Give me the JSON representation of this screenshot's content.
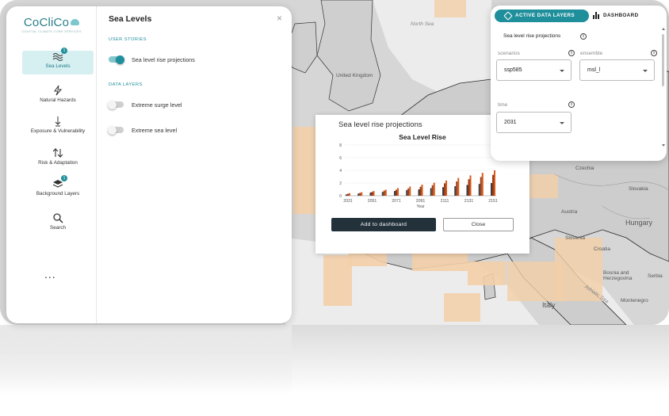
{
  "app": {
    "logo_text": "CoCliCo",
    "logo_tagline": "COASTAL CLIMATE CORE SERVICES"
  },
  "sidebar": {
    "items": [
      {
        "label": "Sea Levels",
        "icon": "waves-icon",
        "badge": "1",
        "active": true
      },
      {
        "label": "Natural Hazards",
        "icon": "lightning-icon"
      },
      {
        "label": "Exposure & Vulnerability",
        "icon": "arrow-down-icon"
      },
      {
        "label": "Risk & Adaptation",
        "icon": "swap-arrows-icon"
      },
      {
        "label": "Background Layers",
        "icon": "layers-icon",
        "badge": "1"
      },
      {
        "label": "Search",
        "icon": "search-icon"
      }
    ],
    "more_label": "..."
  },
  "content": {
    "title": "Sea Levels",
    "close_label": "×",
    "user_stories_heading": "USER STORIES",
    "user_stories": [
      {
        "label": "Sea level rise projections",
        "on": true
      }
    ],
    "data_layers_heading": "DATA LAYERS",
    "data_layers": [
      {
        "label": "Extreme surge level",
        "on": false
      },
      {
        "label": "Extreme sea level",
        "on": false
      }
    ]
  },
  "popup": {
    "title": "Sea level rise projections",
    "add_button": "Add to dashboard",
    "close_button": "Close"
  },
  "chart_data": {
    "type": "bar",
    "title": "Sea Level Rise",
    "xlabel": "Year",
    "ylabel": "",
    "ylim": [
      0,
      8
    ],
    "yticks": [
      0,
      2,
      4,
      6,
      8
    ],
    "x_tick_labels": [
      "2031",
      "2051",
      "2071",
      "2091",
      "2111",
      "2131",
      "2151"
    ],
    "categories": [
      "2031",
      "2041",
      "2051",
      "2061",
      "2071",
      "2081",
      "2091",
      "2101",
      "2111",
      "2121",
      "2131",
      "2141",
      "2151"
    ],
    "series": [
      {
        "color": "#3d3d3d",
        "values": [
          0.2,
          0.35,
          0.5,
          0.6,
          0.75,
          0.9,
          1.0,
          1.2,
          1.35,
          1.5,
          1.7,
          1.85,
          2.0
        ]
      },
      {
        "color": "#9a3b1a",
        "values": [
          0.3,
          0.45,
          0.6,
          0.8,
          0.95,
          1.15,
          1.4,
          1.65,
          1.95,
          2.25,
          2.6,
          2.95,
          3.3
        ]
      },
      {
        "color": "#d65a1a",
        "values": [
          0.4,
          0.55,
          0.75,
          0.95,
          1.2,
          1.45,
          1.75,
          2.05,
          2.4,
          2.8,
          3.2,
          3.6,
          4.0
        ]
      }
    ]
  },
  "right_panel": {
    "active_tab": "ACTIVE DATA LAYERS",
    "dashboard_tab": "DASHBOARD",
    "heading": "Sea level rise projections",
    "scenarios_label": "scenarios",
    "scenarios_value": "ssp585",
    "ensemble_label": "ensemble",
    "ensemble_value": "msl_l",
    "time_label": "time",
    "time_value": "2031"
  },
  "map": {
    "labels": {
      "north_sea": "North Sea",
      "united_kingdom": "United Kingdom",
      "czechia": "Czechia",
      "slovakia": "Slovakia",
      "austria": "Austria",
      "hungary": "Hungary",
      "slovenia": "Slovenia",
      "croatia": "Croatia",
      "bosnia": "Bosnia and Herzegovina",
      "serbia": "Serbia",
      "montenegro": "Montenegro",
      "italy": "Italy",
      "adriatic": "Adriatic Sea"
    },
    "colors": {
      "land": "#d9d9d9",
      "sea": "#ededed",
      "coastal_cells": "#f3cfa8",
      "accent": "#1f8f9c"
    }
  }
}
